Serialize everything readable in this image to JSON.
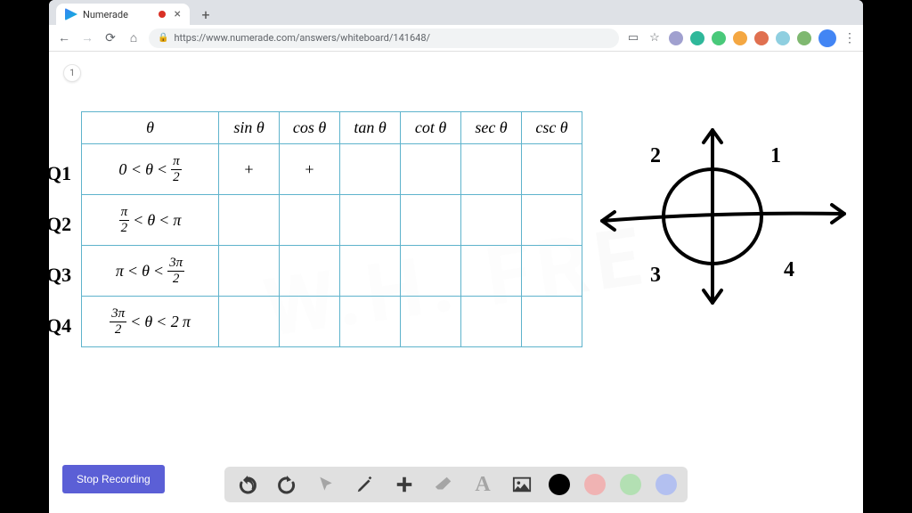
{
  "tab": {
    "title": "Numerade"
  },
  "url": "https://www.numerade.com/answers/whiteboard/141648/",
  "page_number": "1",
  "row_labels": [
    "Q1",
    "Q2",
    "Q3",
    "Q4"
  ],
  "quadrant_labels": {
    "q1": "1",
    "q2": "2",
    "q3": "3",
    "q4": "4"
  },
  "stop_recording": "Stop Recording",
  "colors": {
    "black": "#000000",
    "red": "#f0b3b3",
    "green": "#b3e0b3",
    "blue": "#b3c0f0"
  },
  "chart_data": {
    "type": "table",
    "title": "Signs of trigonometric functions by quadrant",
    "columns": [
      "θ",
      "sin θ",
      "cos θ",
      "tan θ",
      "cot θ",
      "sec θ",
      "csc θ"
    ],
    "rows": [
      {
        "range": "0 < θ < π/2",
        "sin": "+",
        "cos": "+",
        "tan": "",
        "cot": "",
        "sec": "",
        "csc": ""
      },
      {
        "range": "π/2 < θ < π",
        "sin": "",
        "cos": "",
        "tan": "",
        "cot": "",
        "sec": "",
        "csc": ""
      },
      {
        "range": "π < θ < 3π/2",
        "sin": "",
        "cos": "",
        "tan": "",
        "cot": "",
        "sec": "",
        "csc": ""
      },
      {
        "range": "3π/2 < θ < 2π",
        "sin": "",
        "cos": "",
        "tan": "",
        "cot": "",
        "sec": "",
        "csc": ""
      }
    ]
  }
}
